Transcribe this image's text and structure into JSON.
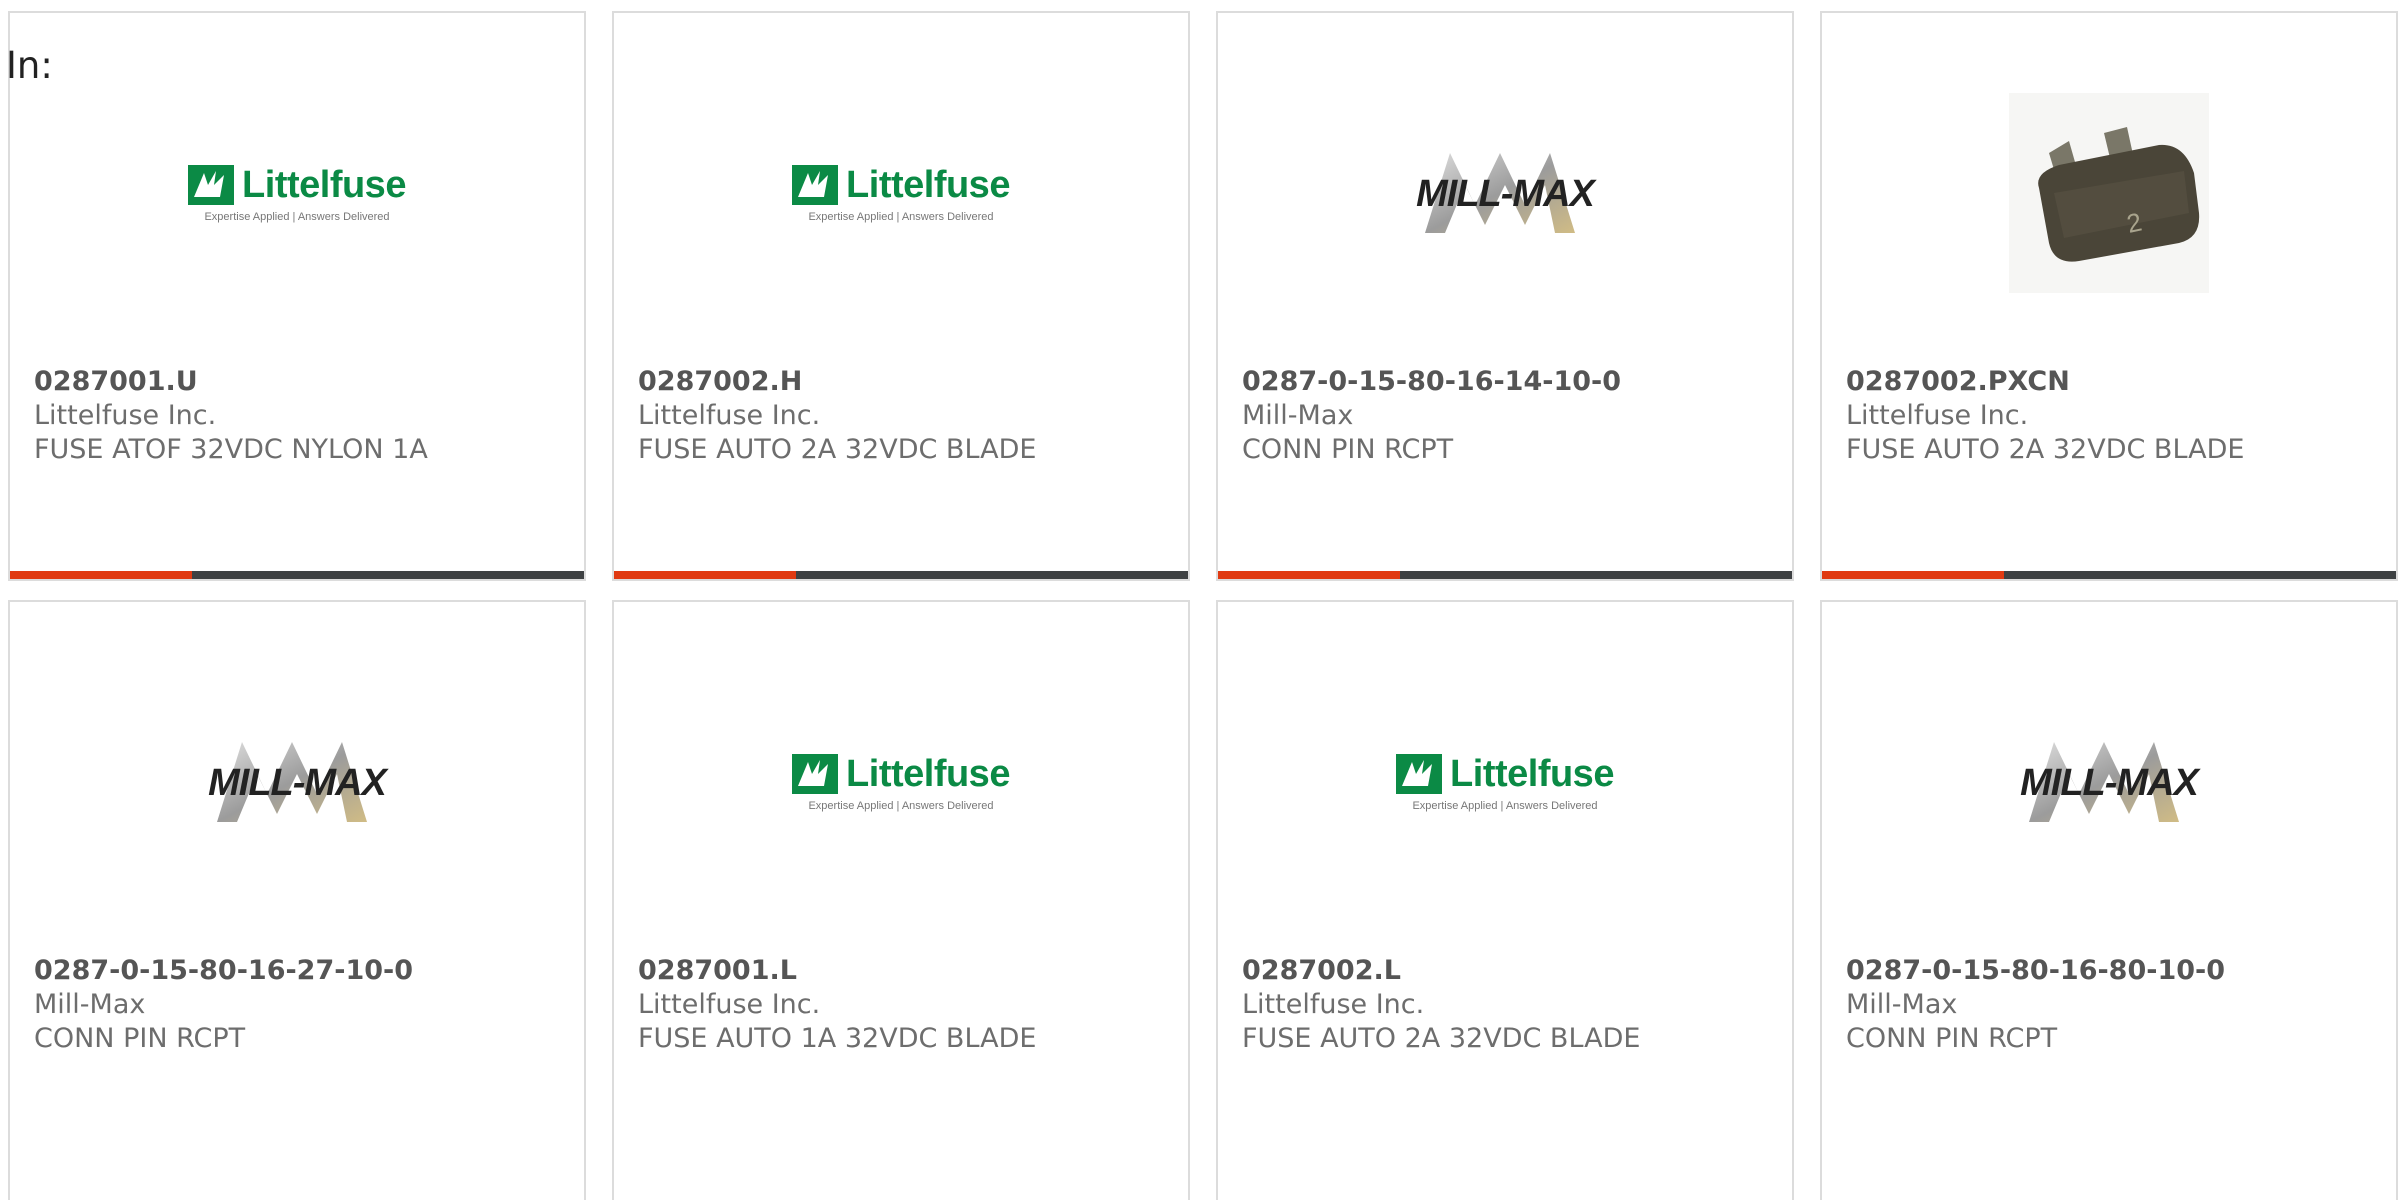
{
  "in_label": "In:",
  "brand_logos": {
    "littelfuse": {
      "name": "Littelfuse",
      "tagline": "Expertise Applied | Answers Delivered",
      "color": "#0b8a45"
    },
    "millmax": {
      "name": "MILL-MAX"
    }
  },
  "accent_color": "#e03a12",
  "products": [
    {
      "part": "0287001.U",
      "manufacturer": "Littelfuse Inc.",
      "description": "FUSE ATOF 32VDC NYLON 1A",
      "image": "littelfuse-logo"
    },
    {
      "part": "0287002.H",
      "manufacturer": "Littelfuse Inc.",
      "description": "FUSE AUTO 2A 32VDC BLADE",
      "image": "littelfuse-logo"
    },
    {
      "part": "0287-0-15-80-16-14-10-0",
      "manufacturer": "Mill-Max",
      "description": "CONN PIN RCPT",
      "image": "millmax-logo"
    },
    {
      "part": "0287002.PXCN",
      "manufacturer": "Littelfuse Inc.",
      "description": "FUSE AUTO 2A 32VDC BLADE",
      "image": "blade-fuse-photo"
    },
    {
      "part": "0287-0-15-80-16-27-10-0",
      "manufacturer": "Mill-Max",
      "description": "CONN PIN RCPT",
      "image": "millmax-logo"
    },
    {
      "part": "0287001.L",
      "manufacturer": "Littelfuse Inc.",
      "description": "FUSE AUTO 1A 32VDC BLADE",
      "image": "littelfuse-logo"
    },
    {
      "part": "0287002.L",
      "manufacturer": "Littelfuse Inc.",
      "description": "FUSE AUTO 2A 32VDC BLADE",
      "image": "littelfuse-logo"
    },
    {
      "part": "0287-0-15-80-16-80-10-0",
      "manufacturer": "Mill-Max",
      "description": "CONN PIN RCPT",
      "image": "millmax-logo"
    }
  ]
}
